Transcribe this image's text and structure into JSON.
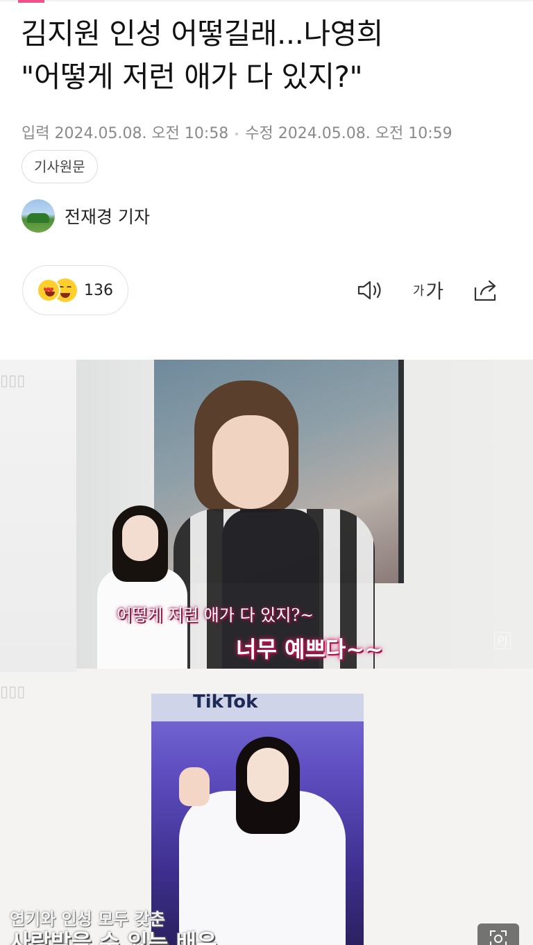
{
  "article": {
    "headline_line1": "김지원 인성 어떻길래...나영희",
    "headline_line2": "\"어떻게 저런 애가 다 있지?\"",
    "input_label": "입력",
    "input_date": "2024.05.08. 오전 10:58",
    "edit_label": "수정",
    "edit_date": "2024.05.08. 오전 10:59",
    "original_button": "기사원문",
    "reporter": "전재경 기자"
  },
  "toolbar": {
    "reaction_count": "136",
    "font_small": "가",
    "font_large": "가",
    "icons": [
      "speaker-icon",
      "font-size-icon",
      "share-icon"
    ]
  },
  "photo": {
    "caption1": "어떻게 저런 애가 다 있지?~",
    "caption2": "너무 예쁘다~~",
    "brand": "TikTok",
    "caption3": "연기와 인성 모두 갖춘",
    "caption4": "사랑받을 수 있는 배우"
  },
  "colors": {
    "accent": "#f0508c",
    "caption_pink": "#e91e63"
  }
}
